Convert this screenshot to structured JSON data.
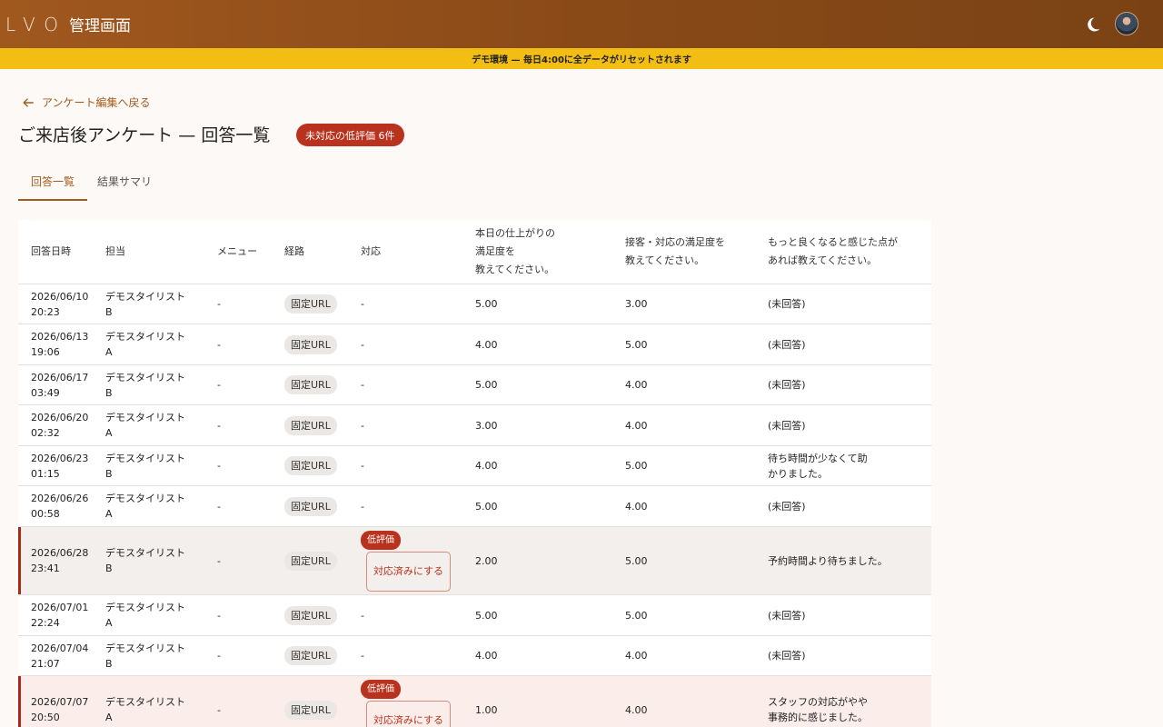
{
  "header": {
    "logo": "LVO",
    "title": "管理画面"
  },
  "banner": {
    "text": "デモ環境 — 毎日4:00に全データがリセットされます"
  },
  "back_link": {
    "label": "アンケート編集へ戻る"
  },
  "page": {
    "title": "ご来店後アンケート — 回答一覧",
    "badge": "未対応の低評価 6件"
  },
  "tabs": [
    {
      "label": "回答一覧"
    },
    {
      "label": "結果サマリ"
    }
  ],
  "table": {
    "headers": [
      "回答日時",
      "担当",
      "メニュー",
      "経路",
      "対応",
      "本日の仕上がりの満足度を教えてください。",
      "接客・対応の満足度を教えてください。",
      "もっと良くなると感じた点があれば教えてください。"
    ],
    "header_lines": {
      "q1": [
        "本日の仕上がりの",
        "満足度を",
        "教えてください。"
      ],
      "q2": [
        "接客・対応の満足度を",
        "教えてください。"
      ],
      "q3": [
        "もっと良くなると感じた点が",
        "あれば教えてください。"
      ]
    },
    "low_label": "低評価",
    "resolve_label": "対応済みにする",
    "rows": [
      {
        "date": "2026/06/10",
        "time": "20:23",
        "staff": "デモスタイリスト",
        "staff_tag": "B",
        "menu": "-",
        "route": "固定URL",
        "response": "-",
        "q1": "5.00",
        "q2": "3.00",
        "q3": "(未回答)"
      },
      {
        "date": "2026/06/13",
        "time": "19:06",
        "staff": "デモスタイリスト",
        "staff_tag": "A",
        "menu": "-",
        "route": "固定URL",
        "response": "-",
        "q1": "4.00",
        "q2": "5.00",
        "q3": "(未回答)"
      },
      {
        "date": "2026/06/17",
        "time": "03:49",
        "staff": "デモスタイリスト",
        "staff_tag": "B",
        "menu": "-",
        "route": "固定URL",
        "response": "-",
        "q1": "5.00",
        "q2": "4.00",
        "q3": "(未回答)"
      },
      {
        "date": "2026/06/20",
        "time": "02:32",
        "staff": "デモスタイリスト",
        "staff_tag": "A",
        "menu": "-",
        "route": "固定URL",
        "response": "-",
        "q1": "3.00",
        "q2": "4.00",
        "q3": "(未回答)"
      },
      {
        "date": "2026/06/23",
        "time": "01:15",
        "staff": "デモスタイリスト",
        "staff_tag": "B",
        "menu": "-",
        "route": "固定URL",
        "response": "-",
        "q1": "4.00",
        "q2": "5.00",
        "q3": "待ち時間が少なくて助かりました。"
      },
      {
        "date": "2026/06/26",
        "time": "00:58",
        "staff": "デモスタイリスト",
        "staff_tag": "A",
        "menu": "-",
        "route": "固定URL",
        "response": "-",
        "q1": "5.00",
        "q2": "4.00",
        "q3": "(未回答)"
      },
      {
        "date": "2026/06/28",
        "time": "23:41",
        "staff": "デモスタイリスト",
        "staff_tag": "B",
        "menu": "-",
        "route": "固定URL",
        "response": "低評価",
        "q1": "2.00",
        "q2": "5.00",
        "q3": "予約時間より待ちました。"
      },
      {
        "date": "2026/07/01",
        "time": "22:24",
        "staff": "デモスタイリスト",
        "staff_tag": "A",
        "menu": "-",
        "route": "固定URL",
        "response": "-",
        "q1": "5.00",
        "q2": "5.00",
        "q3": "(未回答)"
      },
      {
        "date": "2026/07/04",
        "time": "21:07",
        "staff": "デモスタイリスト",
        "staff_tag": "B",
        "menu": "-",
        "route": "固定URL",
        "response": "-",
        "q1": "4.00",
        "q2": "4.00",
        "q3": "(未回答)"
      },
      {
        "date": "2026/07/07",
        "time": "20:50",
        "staff": "デモスタイリスト",
        "staff_tag": "A",
        "menu": "-",
        "route": "固定URL",
        "response": "低評価",
        "q1": "1.00",
        "q2": "4.00",
        "q3": "スタッフの対応がやや事務的に感じました。"
      }
    ]
  },
  "colors": {
    "appbar": "#8a4a18",
    "banner": "#f2be14",
    "accent": "#a35a1c",
    "alert": "#b8321e"
  }
}
